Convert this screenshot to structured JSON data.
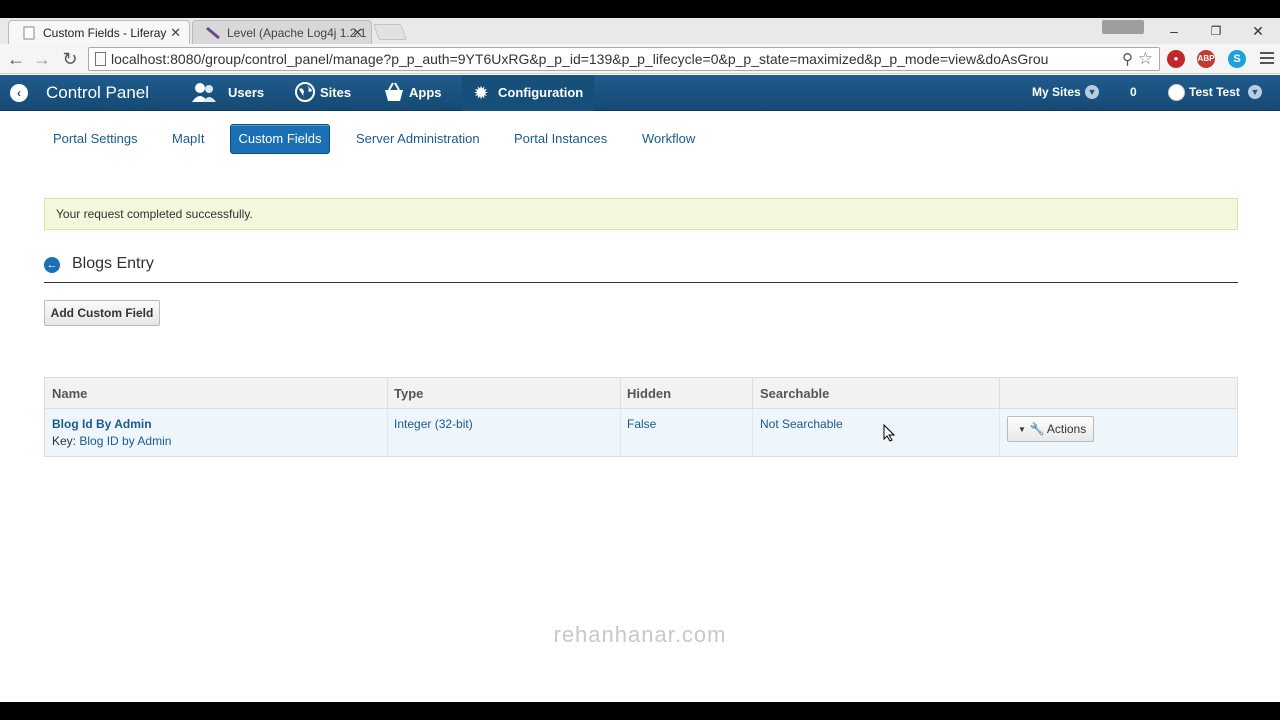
{
  "browser": {
    "tabs": [
      {
        "title": "Custom Fields - Liferay",
        "active": true
      },
      {
        "title": "Level (Apache Log4j 1.2.1",
        "active": false
      }
    ],
    "url": "localhost:8080/group/control_panel/manage?p_p_auth=9YT6UxRG&p_p_id=139&p_p_lifecycle=0&p_p_state=maximized&p_p_mode=view&doAsGrou",
    "extensions": [
      {
        "icon": "stop-icon",
        "color": "#c0282d"
      },
      {
        "icon": "adblock-icon",
        "label": "ABP",
        "color": "#c43a30"
      },
      {
        "icon": "skype-icon",
        "label": "S",
        "color": "#1ea0dc"
      }
    ],
    "window_controls": {
      "minimize": "–",
      "maximize": "❐",
      "close": "✕"
    }
  },
  "control_panel": {
    "title": "Control Panel",
    "items": [
      {
        "label": "Users",
        "icon": "users-icon"
      },
      {
        "label": "Sites",
        "icon": "globe-icon"
      },
      {
        "label": "Apps",
        "icon": "basket-icon"
      },
      {
        "label": "Configuration",
        "icon": "gear-icon"
      }
    ],
    "my_sites": "My Sites",
    "notifications": "0",
    "user": "Test Test"
  },
  "subnav": {
    "items": [
      "Portal Settings",
      "MapIt",
      "Custom Fields",
      "Server Administration",
      "Portal Instances",
      "Workflow"
    ],
    "active": "Custom Fields"
  },
  "alert": {
    "message": "Your request completed successfully."
  },
  "section": {
    "title": "Blogs Entry"
  },
  "add_button": "Add Custom Field",
  "table": {
    "columns": [
      "Name",
      "Type",
      "Hidden",
      "Searchable",
      ""
    ],
    "rows": [
      {
        "name": "Blog Id By Admin",
        "key_label": "Key:",
        "key": "Blog ID by Admin",
        "type": "Integer (32-bit)",
        "hidden": "False",
        "searchable": "Not Searchable",
        "actions": "Actions"
      }
    ]
  },
  "watermark": "rehanhanar.com",
  "colors": {
    "accent": "#1b6fb5",
    "control_panel_bar": "#1b5584",
    "link": "#1a5b8d",
    "success_bg": "#f1f8dc"
  }
}
